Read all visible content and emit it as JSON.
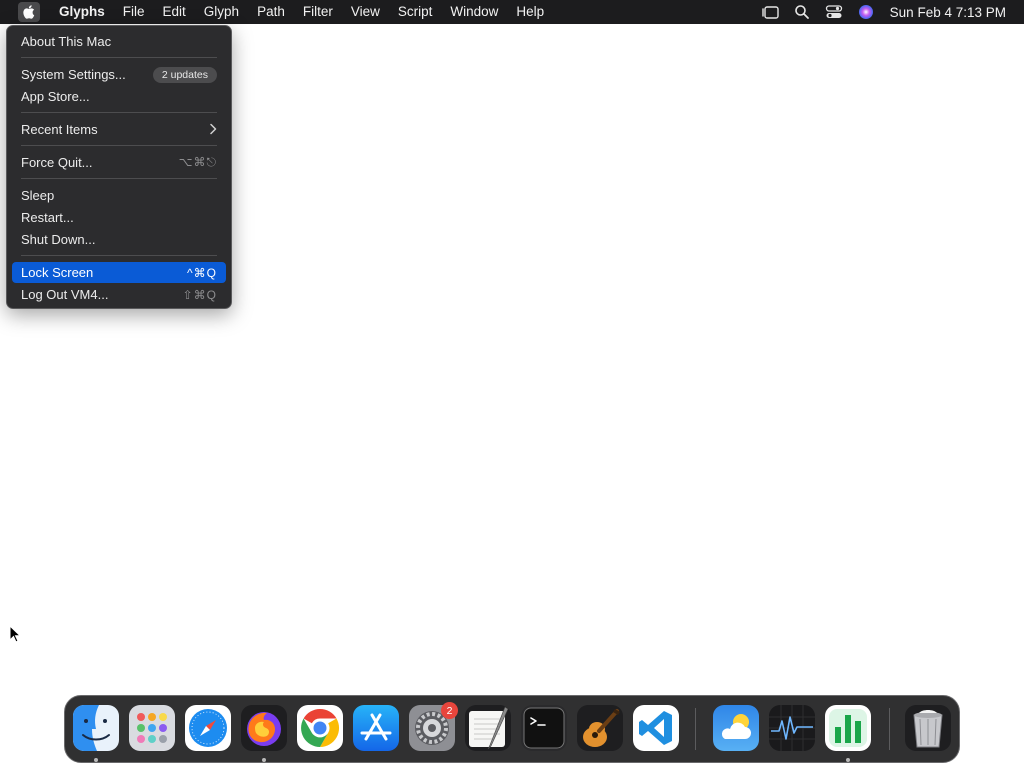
{
  "menubar": {
    "app_name": "Glyphs",
    "menus": [
      "File",
      "Edit",
      "Glyph",
      "Path",
      "Filter",
      "View",
      "Script",
      "Window",
      "Help"
    ],
    "clock": "Sun Feb 4  7:13 PM"
  },
  "apple_menu": {
    "about": "About This Mac",
    "system_settings": "System Settings...",
    "updates_badge": "2 updates",
    "app_store": "App Store...",
    "recent_items": "Recent Items",
    "force_quit": "Force Quit...",
    "force_quit_shortcut": "⌥⌘⎋",
    "sleep": "Sleep",
    "restart": "Restart...",
    "shut_down": "Shut Down...",
    "lock_screen": "Lock Screen",
    "lock_screen_shortcut": "^⌘Q",
    "log_out": "Log Out VM4...",
    "log_out_shortcut": "⇧⌘Q"
  },
  "dock": {
    "apps": [
      "finder-icon",
      "launchpad-icon",
      "safari-icon",
      "firefox-icon",
      "chrome-icon",
      "app-store-icon",
      "system-settings-icon",
      "textedit-icon",
      "terminal-icon",
      "garageband-icon",
      "vscode-icon",
      "weather-icon",
      "activity-monitor-icon",
      "numbers-icon",
      "trash-icon"
    ],
    "settings_badge": "2"
  },
  "colors": {
    "menubar_bg": "#1c1c1e",
    "menu_selection": "#0a5bd6",
    "badge_red": "#e8453c"
  }
}
